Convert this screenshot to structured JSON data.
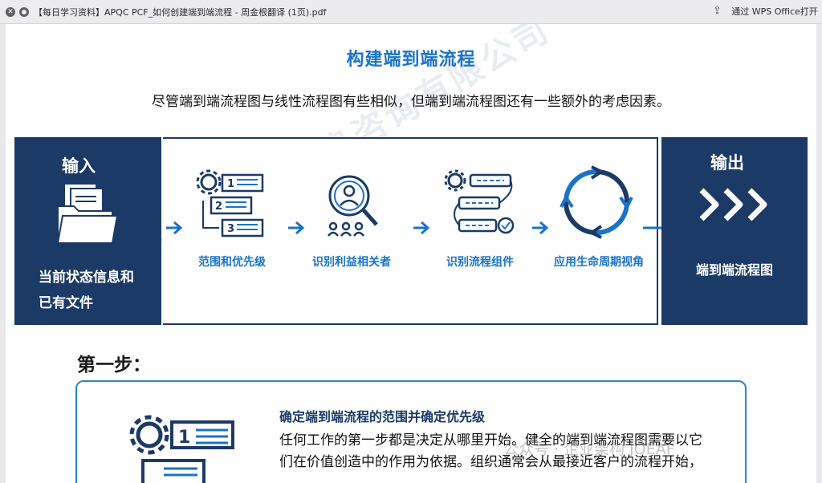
{
  "window": {
    "title": "【每日学习资料】APQC PCF_如何创建端到端流程 - 周金根翻译 (1页).pdf",
    "open_with_label": "通过 WPS Office打开",
    "close_icon": "close-icon",
    "share_icon": "share-icon"
  },
  "page": {
    "title": "构建端到端流程",
    "intro": "尽管端到端流程图与线性流程图有些相似，但端到端流程图还有一些额外的考虑因素。",
    "input": {
      "title": "输入",
      "label_line1": "当前状态信息和",
      "label_line2": "已有文件",
      "icon": "documents-folder-icon"
    },
    "steps": [
      {
        "label": "范围和优先级",
        "icon": "scope-priority-icon"
      },
      {
        "label": "识别利益相关者",
        "icon": "stakeholders-icon"
      },
      {
        "label": "识别流程组件",
        "icon": "process-components-icon"
      },
      {
        "label": "应用生命周期视角",
        "icon": "lifecycle-icon"
      }
    ],
    "output": {
      "title": "输出",
      "label": "端到端流程图",
      "icon": "chevrons-right-icon"
    },
    "step1": {
      "heading": "第一步：",
      "box_title": "确定端到端流程的范围并确定优先级",
      "body_line1": "任何工作的第一步都是决定从哪里开始。健全的端到端流程图需要以它",
      "body_line2": "们在价值创造中的作用为依据。组织通常会从最接近客户的流程开始，"
    },
    "watermark": "北京捷创信息咨询有限公司",
    "overlay_text": "公众号 · 企业架构 JOEAF"
  },
  "colors": {
    "navy": "#1b3a66",
    "accent_blue": "#1a73c8",
    "box_border": "#2a82d4"
  }
}
